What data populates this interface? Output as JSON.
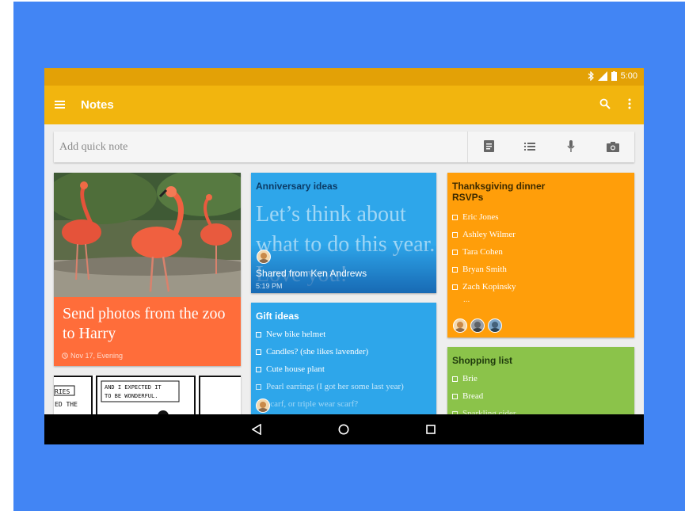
{
  "statusbar": {
    "time": "5:00"
  },
  "appbar": {
    "title": "Notes"
  },
  "quick_note": {
    "placeholder": "Add quick note"
  },
  "notes": {
    "flamingo": {
      "title": "Send photos from the zoo to Harry",
      "reminder": "Nov 17, Evening"
    },
    "comic": {
      "panel1": "RIES ED THE",
      "panel2": "AND I EXPECTED IT TO BE WONDERFUL."
    },
    "anniversary": {
      "title": "Anniversary ideas",
      "body": "Let’s think about what to do this year. Love you!",
      "shared": "Shared from Ken Andrews",
      "time": "5:19 PM"
    },
    "gift": {
      "title": "Gift ideas",
      "items": [
        "New bike helmet",
        "Candles? (she likes lavender)",
        "Cute house plant",
        "Pearl earrings (I got her some last year)",
        "scarf, or triple wear scarf?"
      ]
    },
    "thanksgiving": {
      "title": "Thanksgiving dinner RSVPs",
      "items": [
        "Eric Jones",
        "Ashley Wilmer",
        "Tara Cohen",
        "Bryan Smith",
        "Zach Kopinsky"
      ],
      "more": "..."
    },
    "shopping": {
      "title": "Shopping list",
      "items": [
        "Brie",
        "Bread",
        "Sparkling cider"
      ]
    }
  },
  "colors": {
    "background": "#4285f4",
    "status_bar": "#e3a106",
    "app_bar": "#f2b50e",
    "note_red": "#ff6d3a",
    "note_blue": "#2ea6ea",
    "note_orange": "#ff9e0a",
    "note_green": "#8bc34a"
  },
  "icons": {
    "app_bar": [
      "menu-icon",
      "search-icon",
      "more-vert-icon"
    ],
    "quick_note": [
      "text-note-icon",
      "list-note-icon",
      "mic-icon",
      "camera-icon"
    ],
    "status": [
      "bluetooth-icon",
      "signal-icon",
      "battery-icon"
    ],
    "nav": [
      "back-icon",
      "home-icon",
      "recents-icon"
    ]
  }
}
